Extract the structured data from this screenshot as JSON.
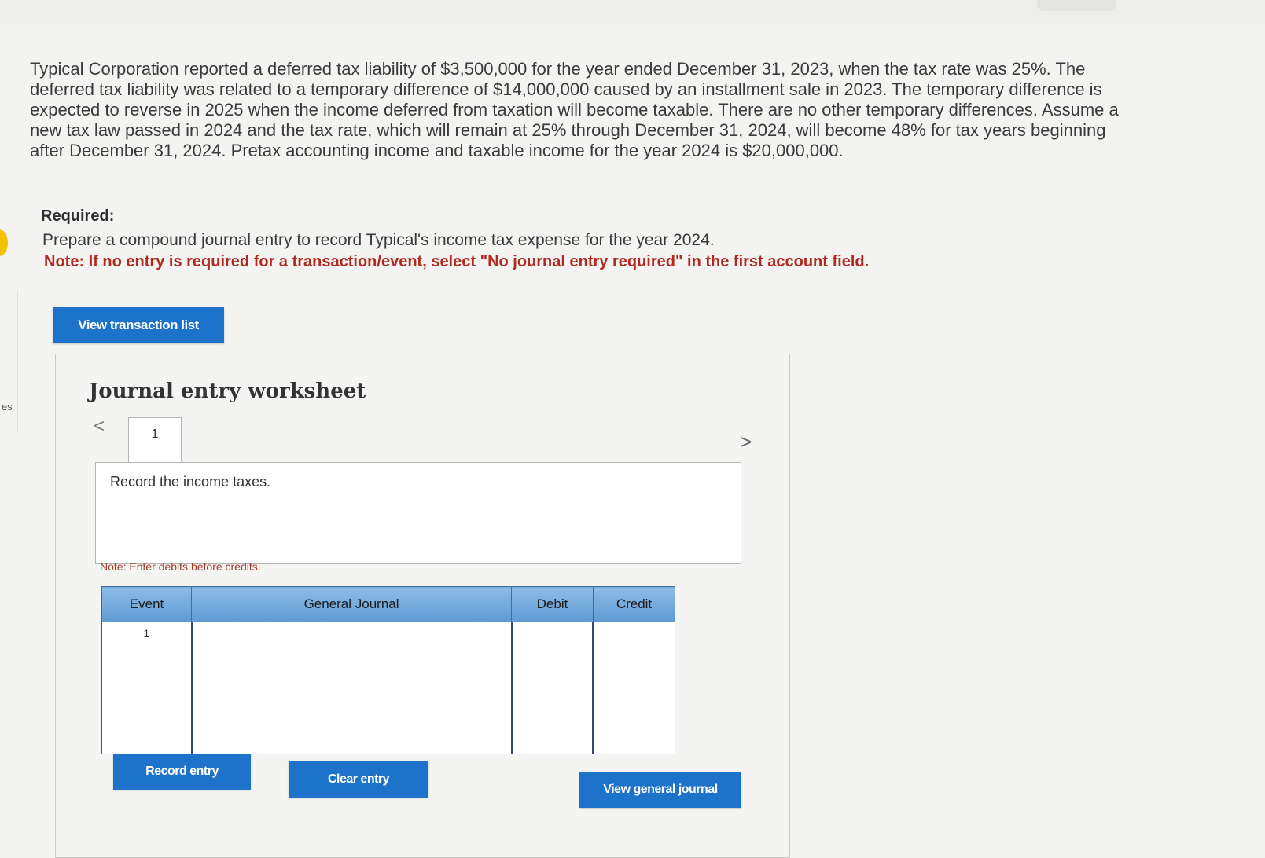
{
  "left_edge_label": "es",
  "problem": {
    "text": "Typical Corporation reported a deferred tax liability of $3,500,000 for the year ended December 31, 2023, when the tax rate was 25%. The deferred tax liability was related to a temporary difference of $14,000,000 caused by an installment sale in 2023. The temporary difference is expected to reverse in 2025 when the income deferred from taxation will become taxable. There are no other temporary differences. Assume a new tax law passed in 2024 and the tax rate, which will remain at 25% through December 31, 2024, will become 48% for tax years beginning after December 31, 2024. Pretax accounting income and taxable income for the year 2024 is $20,000,000."
  },
  "required": {
    "title": "Required:",
    "text": "Prepare a compound journal entry to record Typical's income tax expense for the year 2024.",
    "note": "Note: If no entry is required for a transaction/event, select \"No journal entry required\" in the first account field."
  },
  "buttons": {
    "view_transaction_list": "View transaction list",
    "record_entry": "Record entry",
    "clear_entry": "Clear entry",
    "view_general_journal": "View general journal"
  },
  "worksheet": {
    "title": "Journal entry worksheet",
    "nav_prev": "<",
    "nav_next": ">",
    "tabs": [
      "1"
    ],
    "instruction": "Record the income taxes.",
    "note": "Note: Enter debits before credits."
  },
  "journal_table": {
    "headers": [
      "Event",
      "General Journal",
      "Debit",
      "Credit"
    ],
    "rows": [
      {
        "event": "1",
        "account": "",
        "debit": "",
        "credit": ""
      },
      {
        "event": "",
        "account": "",
        "debit": "",
        "credit": ""
      },
      {
        "event": "",
        "account": "",
        "debit": "",
        "credit": ""
      },
      {
        "event": "",
        "account": "",
        "debit": "",
        "credit": ""
      },
      {
        "event": "",
        "account": "",
        "debit": "",
        "credit": ""
      },
      {
        "event": "",
        "account": "",
        "debit": "",
        "credit": ""
      }
    ]
  },
  "colors": {
    "button_blue": "#1d73c9",
    "header_blue": "#6fa8dc",
    "note_red": "#b22a1f",
    "highlight_yellow": "#f2c300"
  }
}
